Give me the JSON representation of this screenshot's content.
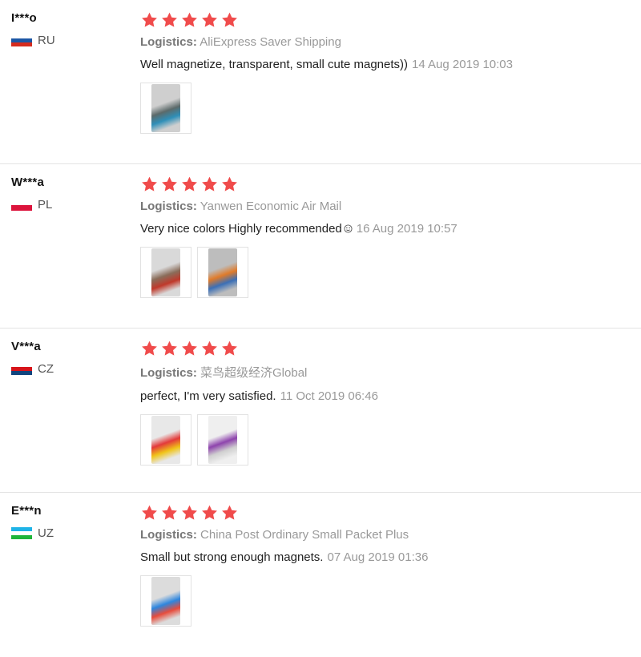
{
  "star_color": "#f04b4b",
  "reviews": [
    {
      "user": "I***o",
      "country": "RU",
      "flag_colors": [
        "#ffffff",
        "#1c57a5",
        "#d52b1e"
      ],
      "logistics_label": "Logistics:",
      "logistics_value": "AliExpress Saver Shipping",
      "feedback": "Well magnetize, transparent, small cute magnets))",
      "date": "14 Aug 2019 10:03",
      "photos": [
        {
          "icon": "photo-thumbnail-icon",
          "colors": [
            "#cfcfcf",
            "#5c6a6a",
            "#2f8fb8"
          ]
        }
      ]
    },
    {
      "user": "W***a",
      "country": "PL",
      "flag_colors": [
        "#ffffff",
        "#dc143c"
      ],
      "logistics_label": "Logistics:",
      "logistics_value": "Yanwen Economic Air Mail",
      "feedback": "Very nice colors Highly recommended",
      "date": "16 Aug 2019 10:57",
      "photos": [
        {
          "icon": "photo-thumbnail-icon",
          "colors": [
            "#d9d9d9",
            "#8a6d5a",
            "#c0392b"
          ]
        },
        {
          "icon": "photo-thumbnail-icon",
          "colors": [
            "#bdbdbd",
            "#e07b2a",
            "#3b6fb6"
          ]
        }
      ]
    },
    {
      "user": "V***a",
      "country": "CZ",
      "flag_colors": [
        "#ffffff",
        "#d7141a",
        "#11457e"
      ],
      "logistics_label": "Logistics:",
      "logistics_value": "菜鸟超级经济Global",
      "feedback": "perfect, I'm very satisfied.",
      "date": "11 Oct 2019 06:46",
      "photos": [
        {
          "icon": "photo-thumbnail-icon",
          "colors": [
            "#e8e8e8",
            "#e33a3a",
            "#f0c419"
          ]
        },
        {
          "icon": "photo-thumbnail-icon",
          "colors": [
            "#efefef",
            "#8e44ad",
            "#d0d0d0"
          ]
        }
      ]
    },
    {
      "user": "E***n",
      "country": "UZ",
      "flag_colors": [
        "#1eb3e7",
        "#ffffff",
        "#1eb53a"
      ],
      "logistics_label": "Logistics:",
      "logistics_value": "China Post Ordinary Small Packet Plus",
      "feedback": "Small but strong enough magnets.",
      "date": "07 Aug 2019 01:36",
      "photos": [
        {
          "icon": "photo-thumbnail-icon",
          "colors": [
            "#dcdcdc",
            "#2e86de",
            "#e74c3c"
          ]
        }
      ]
    }
  ],
  "rating_stars": 5
}
